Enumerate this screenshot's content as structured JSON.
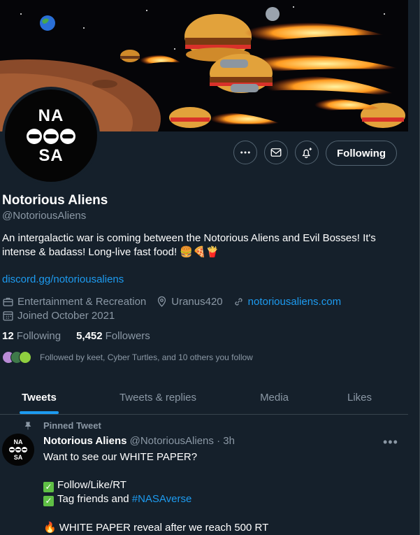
{
  "profile": {
    "avatar_line1": "NA",
    "avatar_line2": "SA",
    "name": "Notorious Aliens",
    "handle": "@NotoriousAliens",
    "bio": "An intergalactic war is coming between the Notorious Aliens and Evil Bosses! It's intense & badass! Long-live fast food! 🍔🍕🍟",
    "bio_link": "discord.gg/notoriousaliens",
    "category": "Entertainment & Recreation",
    "location": "Uranus420",
    "website": "notoriousaliens.com",
    "joined": "Joined October 2021",
    "following_count": "12",
    "following_label": "Following",
    "followers_count": "5,452",
    "followers_label": "Followers",
    "followed_by": "Followed by keet, Cyber Turtles, and 10 others you follow"
  },
  "actions": {
    "follow_label": "Following",
    "more_icon": "more-icon",
    "message_icon": "envelope-icon",
    "notify_icon": "bell-plus-icon"
  },
  "tabs": [
    {
      "label": "Tweets",
      "active": true
    },
    {
      "label": "Tweets & replies",
      "active": false
    },
    {
      "label": "Media",
      "active": false
    },
    {
      "label": "Likes",
      "active": false
    }
  ],
  "pinned_tweet": {
    "pinned_label": "Pinned Tweet",
    "author": "Notorious Aliens",
    "handle": "@NotoriousAliens",
    "time": "· 3h",
    "line1": "Want to see our WHITE PAPER?",
    "line2": "Follow/Like/RT",
    "line3_prefix": "Tag friends and",
    "line3_hashtag": "#NASAverse",
    "line4": "WHITE PAPER reveal after we reach 500 RT"
  },
  "colors": {
    "background": "#15202b",
    "accent": "#1d9bf0",
    "muted": "#8b98a5",
    "border": "#38444d"
  }
}
